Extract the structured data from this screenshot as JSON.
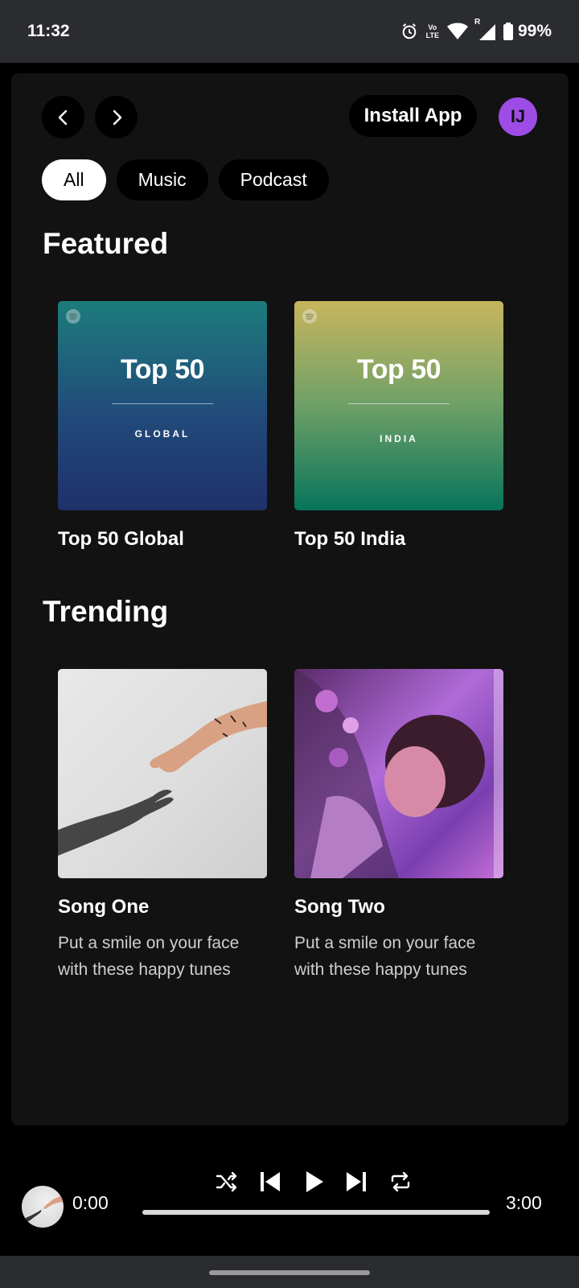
{
  "status_bar": {
    "time": "11:32",
    "volte_line1": "Vo",
    "volte_line2": "LTE",
    "signal_badge": "R",
    "battery": "99%"
  },
  "header": {
    "install_label": "Install App",
    "avatar_initials": "IJ",
    "avatar_color": "#9d4de6"
  },
  "filters": [
    {
      "label": "All",
      "active": true
    },
    {
      "label": "Music",
      "active": false
    },
    {
      "label": "Podcast",
      "active": false
    }
  ],
  "featured": {
    "title": "Featured",
    "items": [
      {
        "title": "Top 50 Global",
        "art_big": "Top 50",
        "art_small": "GLOBAL"
      },
      {
        "title": "Top 50 India",
        "art_big": "Top 50",
        "art_small": "INDIA"
      }
    ]
  },
  "trending": {
    "title": "Trending",
    "items": [
      {
        "title": "Song One",
        "desc": "Put a smile on your face with these happy tunes"
      },
      {
        "title": "Song Two",
        "desc": "Put a smile on your face with these happy tunes"
      }
    ]
  },
  "player": {
    "current_time": "0:00",
    "total_time": "3:00",
    "progress": 0
  },
  "icons": {
    "back": "chevron-left-icon",
    "forward": "chevron-right-icon",
    "shuffle": "shuffle-icon",
    "prev": "skip-previous-icon",
    "play": "play-icon",
    "next": "skip-next-icon",
    "repeat": "repeat-icon"
  }
}
